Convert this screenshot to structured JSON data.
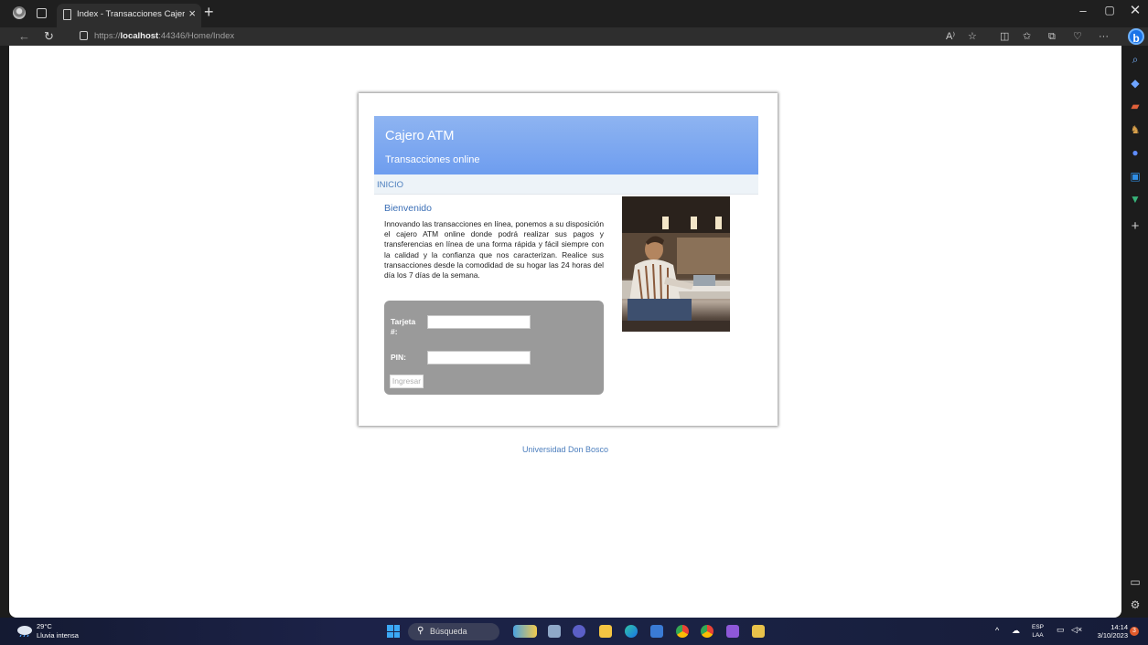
{
  "browser": {
    "tab_title": "Index - Transacciones Cajero ATM",
    "tab_close": "×",
    "new_tab": "+",
    "url_prefix": "https://",
    "url_host": "localhost",
    "url_path": ":44346/Home/Index",
    "window_controls": {
      "minimize": "–",
      "maximize": "▢",
      "close": "✕"
    },
    "toolbar_icons": [
      "read-aloud-icon",
      "favorite-star-icon",
      "split-screen-icon",
      "favorites-icon",
      "collections-icon",
      "browser-essentials-icon",
      "more-icon",
      "copilot-icon"
    ],
    "more_label": "···",
    "copilot_label": "b",
    "sidebar_icons": [
      "search-icon",
      "shopping-tag-icon",
      "tools-icon",
      "games-icon",
      "copilot-app-icon",
      "outlook-icon",
      "designer-icon",
      "add-icon",
      "split-panel-icon",
      "settings-icon"
    ]
  },
  "page": {
    "site_title": "Cajero ATM",
    "site_subtitle": "Transacciones online",
    "menu_item": "INICIO",
    "welcome": "Bienvenido",
    "intro": "Innovando las transacciones en línea, ponemos a su disposición el cajero ATM online donde podrá realizar sus pagos y transferencias en línea de una forma rápida y fácil siempre con la calidad y la confianza que nos caracterizan. Realice sus transacciones desde la comodidad de su hogar las 24 horas del día los 7 días de la semana.",
    "card_label": "Tarjeta #:",
    "pin_label": "PIN:",
    "card_value": "",
    "pin_value": "",
    "submit_label": "Ingresar",
    "footer": "Universidad Don Bosco"
  },
  "taskbar": {
    "weather_temp": "29°C",
    "weather_desc": "Lluvia intensa",
    "search_label": "Búsqueda",
    "apps": [
      "widgets-icon",
      "file-explorer-icon",
      "teams-icon",
      "folder-icon",
      "edge-icon",
      "store-icon",
      "chrome-icon",
      "chrome-alt-icon",
      "visual-studio-icon",
      "app-icon"
    ],
    "lang_1": "ESP",
    "lang_2": "LAA",
    "time": "14:14",
    "date": "3/10/2023",
    "notifications": "3"
  },
  "colors": {
    "header_blue": "#7aa8f0",
    "link_blue": "#4d7fbe",
    "login_panel_gray": "#9a9a9a"
  }
}
